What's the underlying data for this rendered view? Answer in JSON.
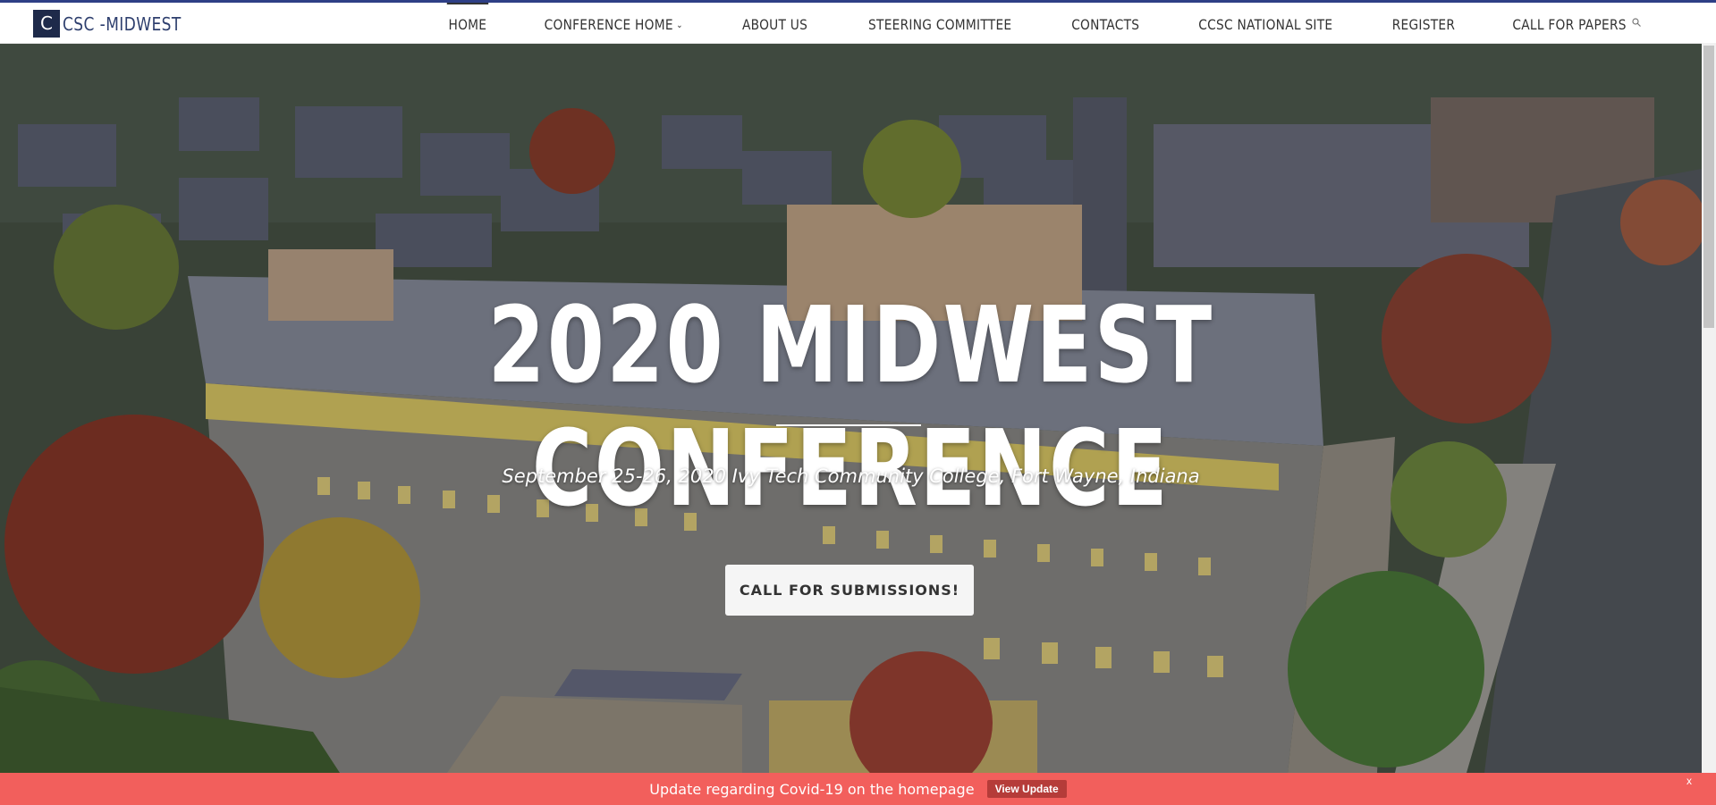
{
  "site": {
    "logo_letter": "C",
    "logo_text": "CSC -MIDWEST"
  },
  "nav": {
    "items": [
      {
        "label": "HOME"
      },
      {
        "label": "CONFERENCE HOME"
      },
      {
        "label": "ABOUT US"
      },
      {
        "label": "STEERING COMMITTEE"
      },
      {
        "label": "CONTACTS"
      },
      {
        "label": "CCSC NATIONAL SITE"
      },
      {
        "label": "REGISTER"
      },
      {
        "label": "CALL FOR PAPERS"
      }
    ],
    "active": "HOME"
  },
  "hero": {
    "title": "2020 MIDWEST CONFERENCE",
    "subtitle": "September 25-26, 2020 Ivy Tech Community College, Fort Wayne, Indiana",
    "cta_label": "CALL FOR SUBMISSIONS!"
  },
  "banner": {
    "message": "Update regarding Covid-19 on the homepage",
    "button_label": "View Update",
    "close_label": "x"
  },
  "colors": {
    "accent": "#2e3f86",
    "banner": "#f25f5c",
    "banner_button": "#b53c39"
  },
  "icons": {
    "search": "search-icon",
    "dropdown": "chevron-down-icon"
  }
}
